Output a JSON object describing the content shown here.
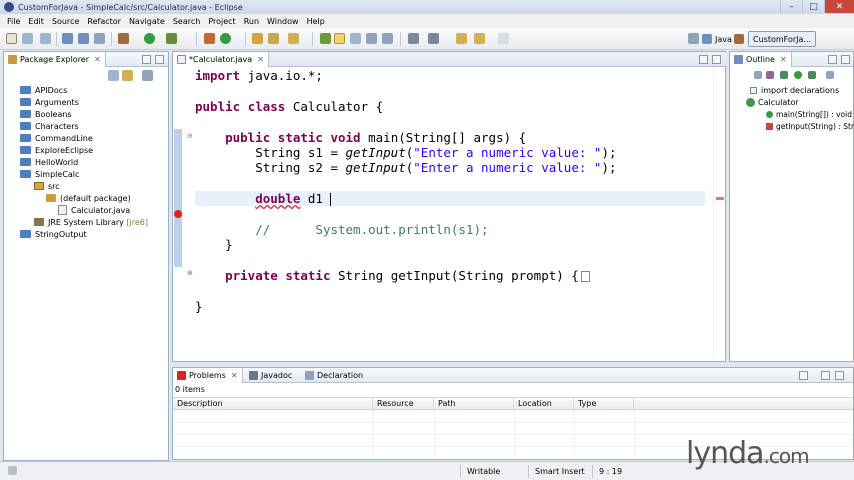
{
  "window": {
    "title": "CustomForJava - SimpleCalc/src/Calculator.java - Eclipse",
    "min": "–",
    "max": "□",
    "close": "✕"
  },
  "menu": [
    "File",
    "Edit",
    "Source",
    "Refactor",
    "Navigate",
    "Search",
    "Project",
    "Run",
    "Window",
    "Help"
  ],
  "perspectives": {
    "java": "Java",
    "custom": "CustomForJa..."
  },
  "package_explorer": {
    "title": "Package Explorer",
    "close": "✕",
    "items": [
      {
        "label": "APIDocs",
        "kind": "project"
      },
      {
        "label": "Arguments",
        "kind": "project"
      },
      {
        "label": "Booleans",
        "kind": "project"
      },
      {
        "label": "Characters",
        "kind": "project"
      },
      {
        "label": "CommandLine",
        "kind": "project"
      },
      {
        "label": "ExploreEclipse",
        "kind": "project"
      },
      {
        "label": "HelloWorld",
        "kind": "project"
      },
      {
        "label": "SimpleCalc",
        "kind": "project"
      },
      {
        "label": "src",
        "kind": "source-folder"
      },
      {
        "label": "(default package)",
        "kind": "package"
      },
      {
        "label": "Calculator.java",
        "kind": "java-file"
      },
      {
        "label": "JRE System Library",
        "tag": "[jre6]",
        "kind": "library"
      },
      {
        "label": "StringOutput",
        "kind": "project"
      }
    ]
  },
  "editor": {
    "tab": "*Calculator.java",
    "close": "✕",
    "lines": {
      "l1": {
        "kw": "import",
        "rest": " java.io.*;"
      },
      "l2": {
        "kw1": "public",
        "kw2": "class",
        "rest": " Calculator {"
      },
      "l3": {
        "kw1": "public",
        "kw2": "static",
        "kw3": "void",
        "rest": " main(String[] args) {"
      },
      "l4": {
        "pre": "String s1 = ",
        "call": "getInput",
        "open": "(",
        "str": "\"Enter a numeric value: \"",
        "end": ");"
      },
      "l5": {
        "pre": "String s2 = ",
        "call": "getInput",
        "open": "(",
        "str": "\"Enter a numeric value: \"",
        "end": ");"
      },
      "l6": {
        "kw": "double",
        "rest": " d1 "
      },
      "l7": {
        "comment": "//      System.out.println(s1);"
      },
      "l8": {
        "rest": "}"
      },
      "l9": {
        "kw1": "private",
        "kw2": "static",
        "rest": " String getInput(String prompt) {"
      },
      "l10": {
        "rest": "}"
      }
    }
  },
  "outline": {
    "title": "Outline",
    "close": "✕",
    "items": [
      {
        "label": "import declarations"
      },
      {
        "label": "Calculator"
      },
      {
        "label": "main(String[]) : void"
      },
      {
        "label": "getInput(String) : String"
      }
    ]
  },
  "problems": {
    "tabs": {
      "problems": "Problems",
      "javadoc": "Javadoc",
      "declaration": "Declaration"
    },
    "close": "✕",
    "count": "0 items",
    "columns": [
      "Description",
      "Resource",
      "Path",
      "Location",
      "Type"
    ]
  },
  "status": {
    "writable": "Writable",
    "insert": "Smart Insert",
    "position": "9 : 19"
  },
  "watermark": {
    "name": "lynda",
    "suffix": ".com"
  },
  "colors": {
    "keyword": "#7f0055",
    "string": "#2a00ff",
    "comment": "#3f7f5f",
    "error": "#d9251c"
  }
}
